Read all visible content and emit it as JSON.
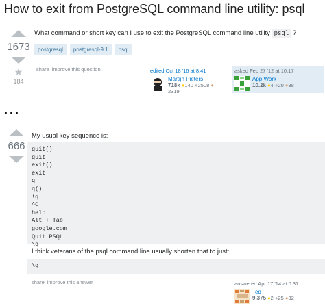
{
  "page": {
    "title": "How to exit from PostgreSQL command line utility: psql"
  },
  "question": {
    "votes": "1673",
    "favorites": "184",
    "text_before": "What command or short key can I use to exit the PostgreSQL command line utility ",
    "text_code": "psql",
    "text_after": " ?",
    "tags": [
      "postgresql",
      "postgresql-9.1",
      "psql"
    ],
    "menu": {
      "share": "share",
      "improve": "improve this question"
    },
    "edited": {
      "when": "edited Oct 18 '16 at 8:41",
      "user": "Martijn Pieters",
      "rep": "718k",
      "gold": "140",
      "silver": "2508",
      "bronze": "2319"
    },
    "asked": {
      "when": "asked Feb 27 '12 at 10:17",
      "user": "App Work",
      "rep": "10.2k",
      "gold": "4",
      "silver": "20",
      "bronze": "38"
    }
  },
  "ellipsis": "...",
  "answer": {
    "votes": "666",
    "intro": "My usual key sequence is:",
    "code_lines": [
      "quit()",
      "quit",
      "exit()",
      "exit",
      "q",
      "q()",
      "!q",
      "^C",
      "help",
      "Alt + Tab",
      "google.com",
      "Quit PSQL",
      "\\q"
    ],
    "outro": "I think veterans of the psql command line usually shorten that to just:",
    "code2": "\\q",
    "menu": {
      "share": "share",
      "improve": "improve this answer"
    },
    "answered": {
      "when": "answered Apr 17 '14 at 0:31",
      "user": "Ted",
      "rep": "9,375",
      "gold": "2",
      "silver": "25",
      "bronze": "32"
    }
  },
  "colors": {
    "link": "#0077cc",
    "tag_bg": "#e1ecf4",
    "tag_fg": "#39739d",
    "code_bg": "#eff0f1",
    "gold": "#ffcc01",
    "silver": "#b4b8bc",
    "bronze": "#d1a684"
  }
}
